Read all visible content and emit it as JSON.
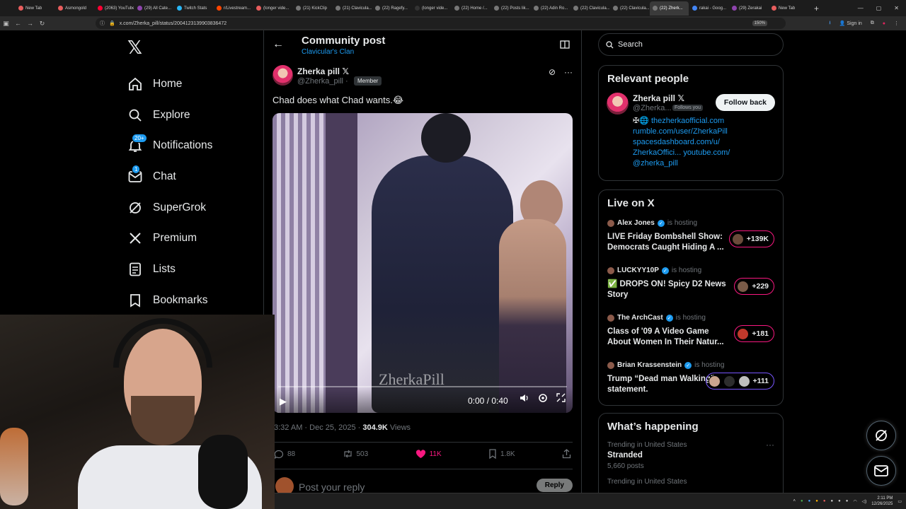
{
  "browser": {
    "tabs": [
      {
        "label": "New Tab",
        "color": "#e85d5d"
      },
      {
        "label": "Asmongold",
        "color": "#e85d5d"
      },
      {
        "label": "(2063) YouTube",
        "color": "#ff0033"
      },
      {
        "label": "(29) All Cate...",
        "color": "#8e44ad"
      },
      {
        "label": "Twitch Stats",
        "color": "#29b6f6"
      },
      {
        "label": "r/Livestream...",
        "color": "#ff4500"
      },
      {
        "label": "(longer vide...",
        "color": "#e85d5d"
      },
      {
        "label": "(21) KickClip",
        "color": "#777777"
      },
      {
        "label": "(21) Clavicula...",
        "color": "#777777"
      },
      {
        "label": "(22) Ragefy...",
        "color": "#777777"
      },
      {
        "label": "(longer vide...",
        "color": "#333333"
      },
      {
        "label": "(22) Home /...",
        "color": "#777777"
      },
      {
        "label": "(22) Posts lik...",
        "color": "#777777"
      },
      {
        "label": "(22) Adin Ro...",
        "color": "#777777"
      },
      {
        "label": "(22) Clavicula...",
        "color": "#777777"
      },
      {
        "label": "(22) Clavicula...",
        "color": "#777777"
      },
      {
        "label": "(22) Zherk...",
        "color": "#777777",
        "active": true
      },
      {
        "label": "rakai - Goog...",
        "color": "#4285f4"
      },
      {
        "label": "(29) Zerakai",
        "color": "#8e44ad"
      },
      {
        "label": "New Tab",
        "color": "#e85d5d"
      }
    ],
    "new_tab": "+",
    "url": "x.com/Zherka_pill/status/2004123139903836472",
    "zoom": "150%",
    "sign_in": "Sign in"
  },
  "leftnav": {
    "logo": "𝕏",
    "items": [
      {
        "label": "Home",
        "icon": "home-icon"
      },
      {
        "label": "Explore",
        "icon": "search-icon"
      },
      {
        "label": "Notifications",
        "icon": "bell-icon",
        "badge": "20+"
      },
      {
        "label": "Chat",
        "icon": "mail-icon",
        "badge": "1"
      },
      {
        "label": "SuperGrok",
        "icon": "grok-icon"
      },
      {
        "label": "Premium",
        "icon": "x-logo-icon"
      },
      {
        "label": "Lists",
        "icon": "list-icon"
      },
      {
        "label": "Bookmarks",
        "icon": "bookmark-icon"
      }
    ]
  },
  "post": {
    "header_title": "Community post",
    "header_subtitle": "Clavicular's Clan",
    "author_name": "Zherka pill 𝕏",
    "author_handle": "@Zherka_pill ·",
    "member_badge": "Member",
    "text": "Chad does what Chad wants.😂",
    "video": {
      "watermark": "ZherkaPill",
      "time": "0:00 / 0:40",
      "progress": 0.0
    },
    "timestamp": "3:32 AM · Dec 25, 2025 ·",
    "views_count": "304.9K",
    "views_label": "Views",
    "replies": "88",
    "reposts": "503",
    "likes": "11K",
    "bookmarks": "1.8K",
    "reply_placeholder": "Post your reply",
    "reply_button": "Reply"
  },
  "sidebar": {
    "search_placeholder": "Search",
    "relevant_title": "Relevant people",
    "person": {
      "name": "Zherka pill 𝕏",
      "handle": "@Zherka...",
      "follows_you": "Follows you",
      "follow_button": "Follow back",
      "bio_prefix": "✠🌐",
      "bio_link1": "thezherkaofficial.com",
      "bio_link2": "rumble.com/user/ZherkaPill",
      "bio_link3": "spacesdashboard.com/u/",
      "bio_link4": "ZherkaOffici... youtube.com/",
      "bio_link5": "@zherka_pill"
    },
    "live_title": "Live on X",
    "live": [
      {
        "host": "Alex Jones",
        "status": "is hosting",
        "title": "LIVE Friday Bombshell Show: Democrats Caught Hiding A ...",
        "count": "+139K"
      },
      {
        "host": "LUCKYY10P",
        "status": "is hosting",
        "title": "✅ DROPS ON! Spicy D2 News Story",
        "count": "+229"
      },
      {
        "host": "The ArchCast",
        "status": "is hosting",
        "title": "Class of '09 A Video Game About Women In Their Natur...",
        "count": "+181"
      },
      {
        "host": "Brian Krassenstein",
        "status": "is hosting",
        "title": "Trump “Dead man Walking” statement.",
        "count": "+111"
      }
    ],
    "happening_title": "What’s happening",
    "trend": {
      "context": "Trending in United States",
      "name": "Stranded",
      "posts": "5,660 posts",
      "context2": "Trending in United States"
    }
  },
  "taskbar": {
    "time": "2:11 PM",
    "date": "12/26/2025"
  }
}
